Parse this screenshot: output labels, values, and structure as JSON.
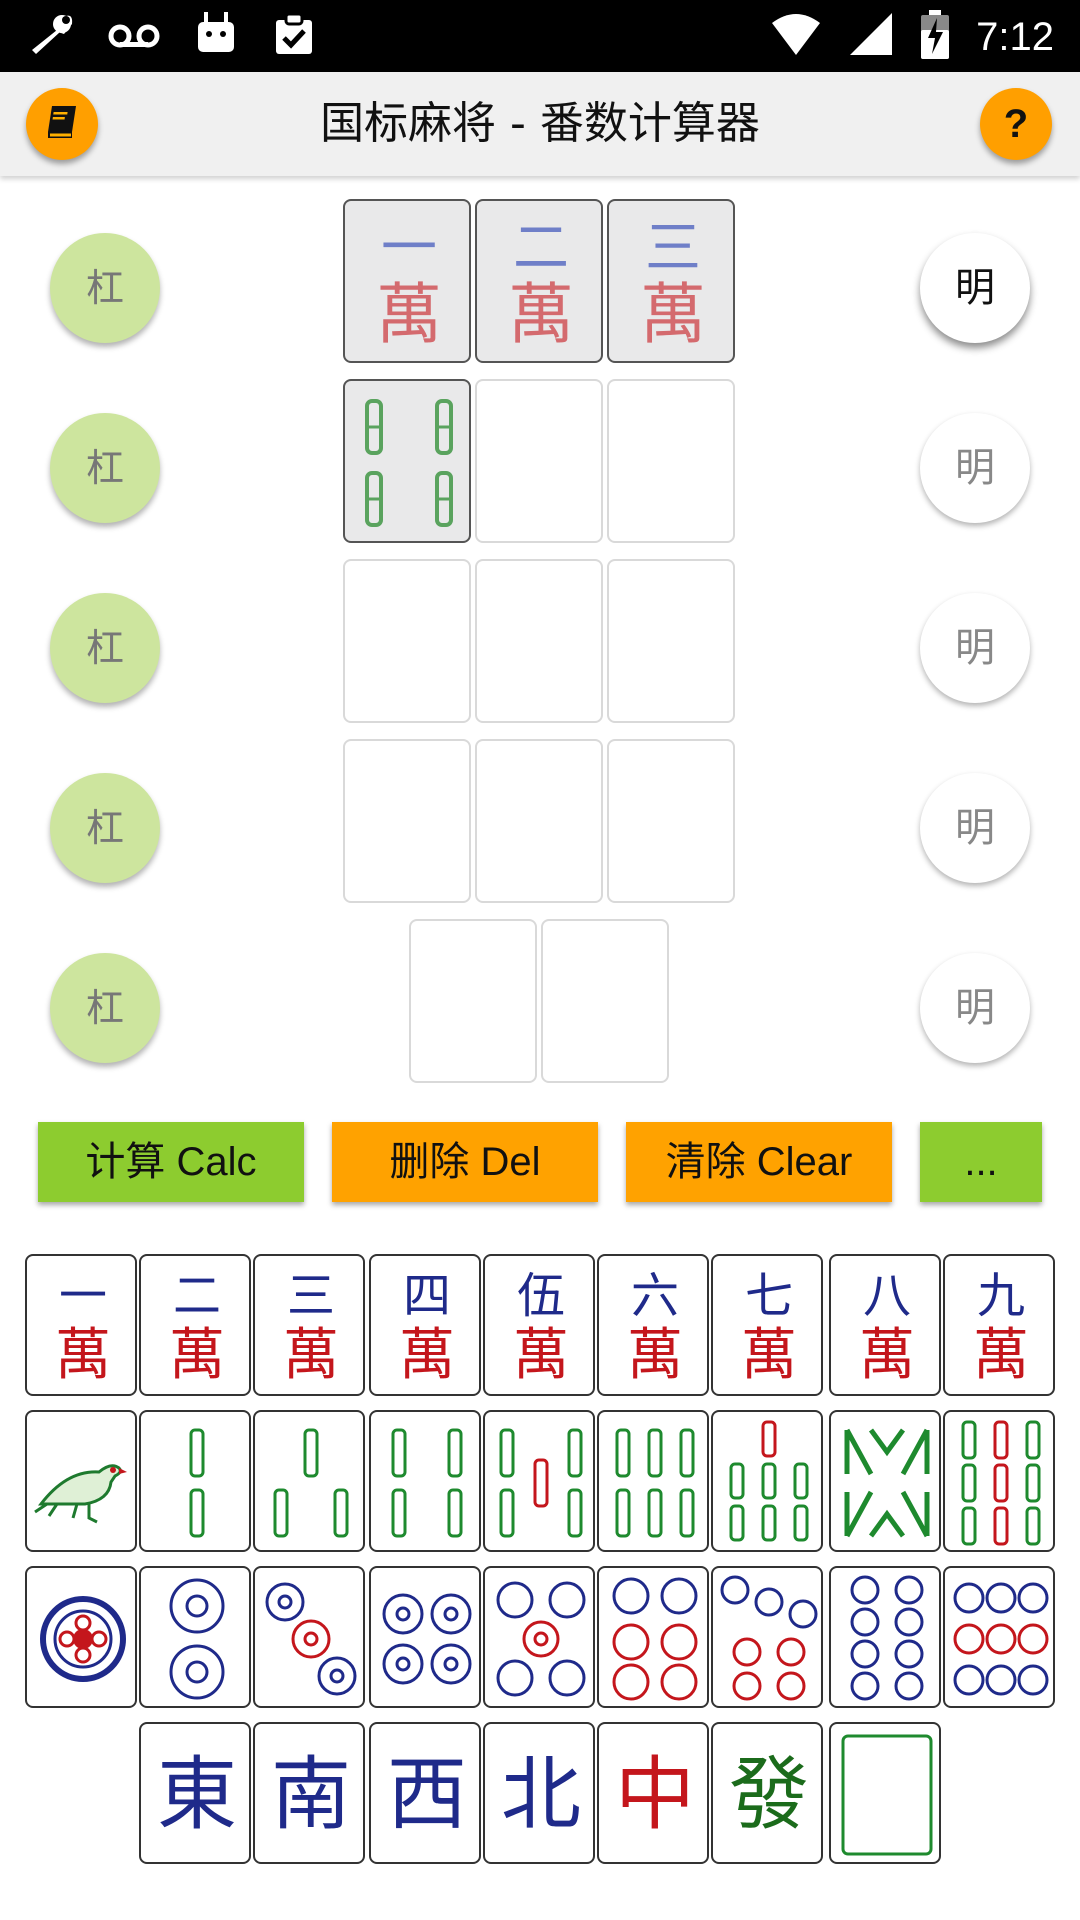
{
  "status_bar": {
    "time": "7:12",
    "icons": [
      "wrench-icon",
      "voicemail-icon",
      "android-icon",
      "clipboard-check-icon",
      "wifi-icon",
      "signal-icon",
      "battery-icon"
    ]
  },
  "app_bar": {
    "title": "国标麻将 - 番数计算器",
    "help_label": "?"
  },
  "melds": {
    "kong_label": "杠",
    "ming_label": "明",
    "rows": [
      {
        "tiles": [
          "1m",
          "2m",
          "3m"
        ],
        "ming_active": true
      },
      {
        "tiles": [
          "4s",
          "",
          ""
        ],
        "ming_active": false
      },
      {
        "tiles": [
          "",
          "",
          ""
        ],
        "ming_active": false
      },
      {
        "tiles": [
          "",
          "",
          ""
        ],
        "ming_active": false
      },
      {
        "tiles": [
          "",
          ""
        ],
        "ming_active": false
      }
    ]
  },
  "actions": {
    "calc": "计算 Calc",
    "del": "删除 Del",
    "clear": "清除 Clear",
    "more": "..."
  },
  "tiles_text": {
    "wan_char": "萬",
    "wan_numerals": [
      "一",
      "二",
      "三",
      "四",
      "伍",
      "六",
      "七",
      "八",
      "九"
    ],
    "honors": [
      "東",
      "南",
      "西",
      "北",
      "中",
      "發"
    ]
  },
  "colors": {
    "accent_orange": "#ffa200",
    "accent_green": "#8dcc2f",
    "kong_green": "#cde59e",
    "numeral_blue": "#1f2a8a",
    "wan_red": "#c4161c",
    "bamboo_green": "#1e8a2e"
  }
}
